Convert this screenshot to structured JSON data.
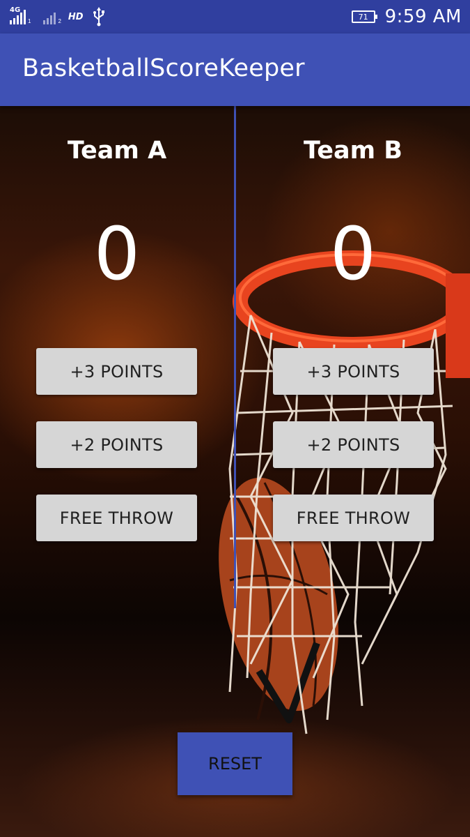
{
  "status_bar": {
    "network_type": "4G",
    "sim1_index": "1",
    "sim2_index": "2",
    "hd_label": "HD",
    "battery_level": "71",
    "time": "9:59 AM"
  },
  "app_bar": {
    "title": "BasketballScoreKeeper"
  },
  "team_a": {
    "name": "Team A",
    "score": "0",
    "btn_three": "+3 POINTS",
    "btn_two": "+2 POINTS",
    "btn_free": "FREE THROW"
  },
  "team_b": {
    "name": "Team B",
    "score": "0",
    "btn_three": "+3 POINTS",
    "btn_two": "+2 POINTS",
    "btn_free": "FREE THROW"
  },
  "reset_label": "RESET",
  "colors": {
    "status_bar": "#303f9f",
    "primary": "#3f51b5",
    "button_bg": "#d6d6d6",
    "rim": "#e8441f"
  },
  "icons": {
    "usb": "usb-icon",
    "battery": "battery-icon",
    "signal": "signal-icon",
    "background": "basketball-hoop-photo"
  }
}
